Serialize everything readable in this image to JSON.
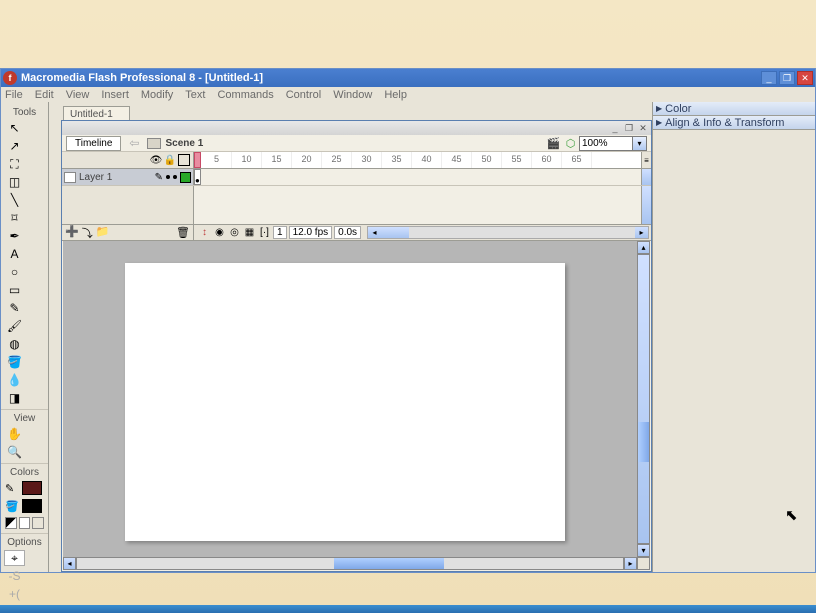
{
  "titlebar": {
    "app_title": "Macromedia Flash Professional 8 - [Untitled-1]"
  },
  "menubar": [
    "File",
    "Edit",
    "View",
    "Insert",
    "Modify",
    "Text",
    "Commands",
    "Control",
    "Window",
    "Help"
  ],
  "tools": {
    "title": "Tools",
    "view_title": "View",
    "colors_title": "Colors",
    "options_title": "Options"
  },
  "document": {
    "tab": "Untitled-1",
    "timeline_btn": "Timeline",
    "scene": "Scene 1",
    "zoom": "100%"
  },
  "ruler": [
    "5",
    "10",
    "15",
    "20",
    "25",
    "30",
    "35",
    "40",
    "45",
    "50",
    "55",
    "60",
    "65"
  ],
  "layer": {
    "name": "Layer 1"
  },
  "footer": {
    "frame": "1",
    "fps": "12.0 fps",
    "time": "0.0s"
  },
  "panels": {
    "color": "Color",
    "align": "Align & Info & Transform"
  }
}
